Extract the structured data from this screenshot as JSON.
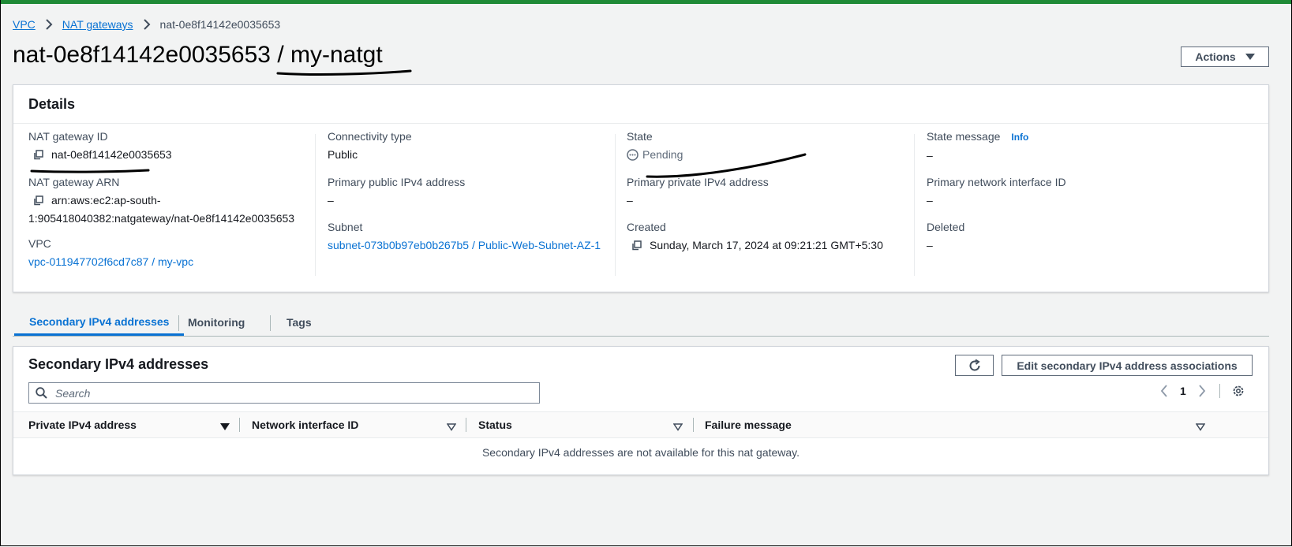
{
  "breadcrumb": {
    "vpc": "VPC",
    "nat_gateways": "NAT gateways",
    "current": "nat-0e8f14142e0035653"
  },
  "page_title": "nat-0e8f14142e0035653 / my-natgt",
  "actions_label": "Actions",
  "details": {
    "title": "Details",
    "nat_gateway_id_label": "NAT gateway ID",
    "nat_gateway_id": "nat-0e8f14142e0035653",
    "nat_gateway_arn_label": "NAT gateway ARN",
    "nat_gateway_arn_line1": "arn:aws:ec2:ap-south-",
    "nat_gateway_arn_line2": "1:905418040382:natgateway/nat-0e8f14142e0035653",
    "vpc_label": "VPC",
    "vpc_value": "vpc-011947702f6cd7c87 / my-vpc",
    "connectivity_label": "Connectivity type",
    "connectivity_value": "Public",
    "public_ip_label": "Primary public IPv4 address",
    "public_ip_value": "–",
    "subnet_label": "Subnet",
    "subnet_value": "subnet-073b0b97eb0b267b5 / Public-Web-Subnet-AZ-1",
    "state_label": "State",
    "state_value": "Pending",
    "private_ip_label": "Primary private IPv4 address",
    "private_ip_value": "–",
    "created_label": "Created",
    "created_value": "Sunday, March 17, 2024 at 09:21:21 GMT+5:30",
    "state_message_label": "State message",
    "info_label": "Info",
    "state_message_value": "–",
    "network_interface_label": "Primary network interface ID",
    "network_interface_value": "–",
    "deleted_label": "Deleted",
    "deleted_value": "–"
  },
  "tabs": [
    "Secondary IPv4 addresses",
    "Monitoring",
    "Tags"
  ],
  "secondary": {
    "title": "Secondary IPv4 addresses",
    "edit_button": "Edit secondary IPv4 address associations",
    "search_placeholder": "Search",
    "page_number": "1",
    "columns": [
      "Private IPv4 address",
      "Network interface ID",
      "Status",
      "Failure message"
    ],
    "empty_message": "Secondary IPv4 addresses are not available for this nat gateway."
  },
  "colors": {
    "accent": "#0972d3",
    "top_bar": "#1f8a36"
  },
  "icons": [
    "chevron-right-icon",
    "caret-down-icon",
    "copy-icon",
    "pending-icon",
    "refresh-icon",
    "search-icon",
    "chevron-left-icon",
    "settings-icon",
    "sort-icon"
  ]
}
